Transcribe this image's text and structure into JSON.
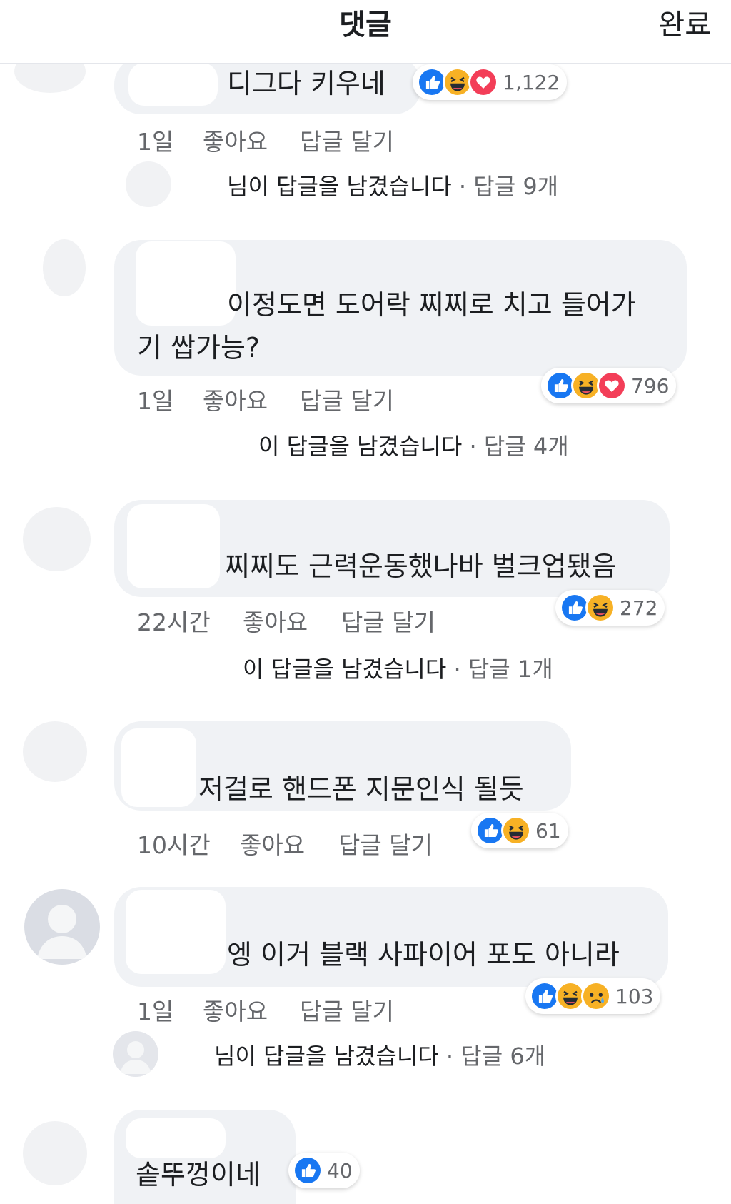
{
  "header": {
    "title": "댓글",
    "done": "완료"
  },
  "comments": [
    {
      "text_lines": [
        "디그다 키우네"
      ],
      "time": "1일",
      "like": "좋아요",
      "reply": "답글 달기",
      "reactions": [
        "like",
        "haha",
        "love"
      ],
      "reaction_count": "1,122",
      "reply_summary": "님이 답글을 남겼습니다",
      "reply_count": "답글 9개"
    },
    {
      "text_lines": [
        "이정도면 도어락 찌찌로 치고 들어가",
        "기 쌉가능?"
      ],
      "time": "1일",
      "like": "좋아요",
      "reply": "답글 달기",
      "reactions": [
        "like",
        "haha",
        "love"
      ],
      "reaction_count": "796",
      "reply_summary": "이 답글을 남겼습니다",
      "reply_count": "답글 4개"
    },
    {
      "text_lines": [
        "찌찌도 근력운동했나바 벌크업됐음"
      ],
      "time": "22시간",
      "like": "좋아요",
      "reply": "답글 달기",
      "reactions": [
        "like",
        "haha"
      ],
      "reaction_count": "272",
      "reply_summary": "이 답글을 남겼습니다",
      "reply_count": "답글 1개"
    },
    {
      "text_lines": [
        "저걸로 핸드폰 지문인식 될듯"
      ],
      "time": "10시간",
      "like": "좋아요",
      "reply": "답글 달기",
      "reactions": [
        "like",
        "haha"
      ],
      "reaction_count": "61"
    },
    {
      "text_lines": [
        "엥 이거 블랙 사파이어 포도 아니라"
      ],
      "time": "1일",
      "like": "좋아요",
      "reply": "답글 달기",
      "reactions": [
        "like",
        "haha",
        "sad"
      ],
      "reaction_count": "103",
      "reply_summary": "님이 답글을 남겼습니다",
      "reply_count": "답글 6개"
    },
    {
      "text_lines": [
        "솥뚜껑이네"
      ],
      "reactions": [
        "like"
      ],
      "reaction_count": "40"
    }
  ],
  "colors": {
    "like": "#1877f2",
    "haha": "#f7b125",
    "love": "#f33e58",
    "sad": "#f7b125",
    "bubble": "#f0f2f5",
    "meta": "#65676b"
  },
  "icons": {
    "like": "thumbs-up-icon",
    "haha": "laughing-face-icon",
    "love": "heart-icon",
    "sad": "sad-face-icon"
  }
}
